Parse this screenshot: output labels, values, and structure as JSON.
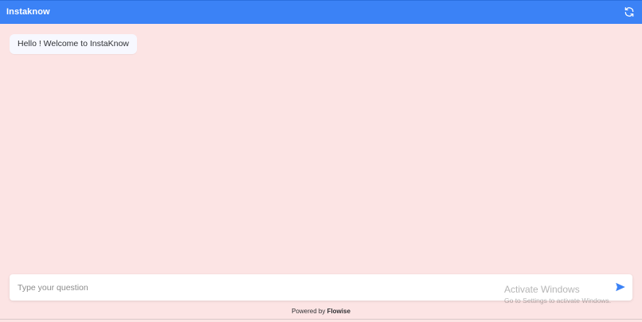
{
  "header": {
    "title": "Instaknow",
    "refresh_icon": "refresh-icon"
  },
  "chat": {
    "messages": [
      {
        "role": "bot",
        "text": "Hello ! Welcome to InstaKnow"
      }
    ]
  },
  "input": {
    "placeholder": "Type your question",
    "value": "",
    "send_icon": "send-icon"
  },
  "footer": {
    "prefix": "Powered by",
    "brand": "Flowise"
  },
  "watermark": {
    "title": "Activate Windows",
    "subtitle": "Go to Settings to activate Windows."
  },
  "colors": {
    "header_bg": "#3b82f6",
    "page_bg": "#fce4e4",
    "bubble_bg": "#f7f8ff",
    "accent": "#3b82f6"
  }
}
